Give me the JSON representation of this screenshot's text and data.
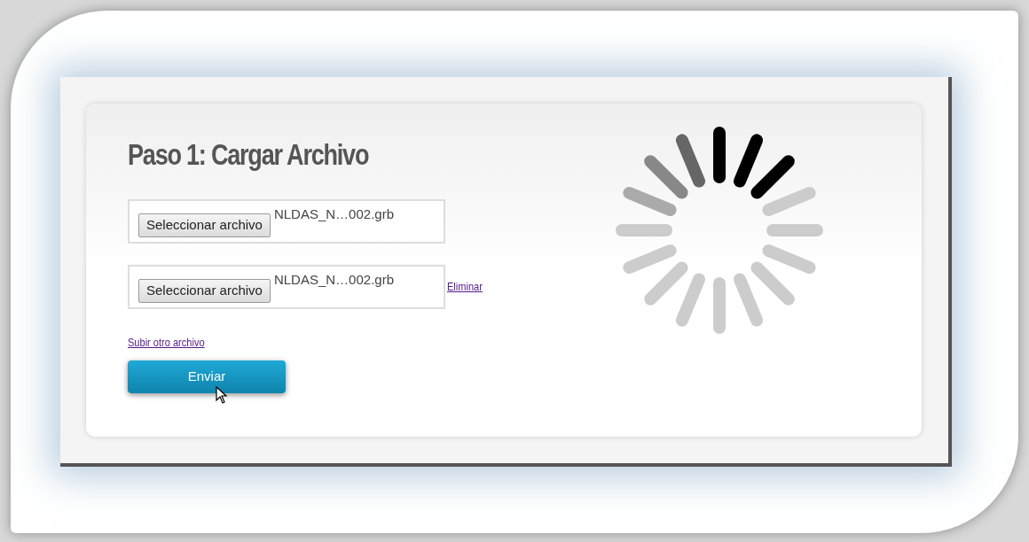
{
  "heading": "Paso 1: Cargar Archivo",
  "file_inputs": [
    {
      "button": "Seleccionar archivo",
      "file_name": "NLDAS_N…002.grb"
    },
    {
      "button": "Seleccionar archivo",
      "file_name": "NLDAS_N…002.grb",
      "remove_link": "Eliminar"
    }
  ],
  "add_link": "Subir otro archivo",
  "submit_button": "Enviar"
}
